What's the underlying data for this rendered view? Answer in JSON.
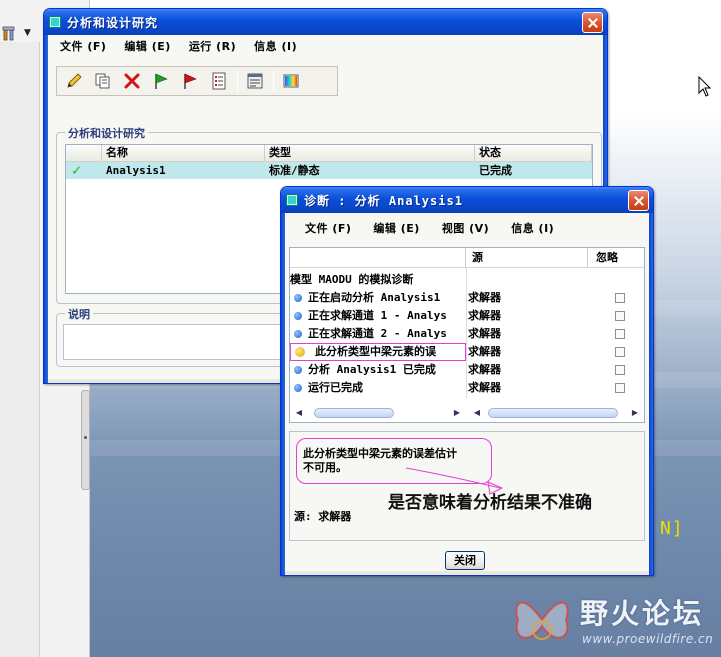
{
  "main_window": {
    "title": "分析和设计研究",
    "menu": [
      {
        "label": "文件 (F)"
      },
      {
        "label": "编辑 (E)"
      },
      {
        "label": "运行 (R)"
      },
      {
        "label": "信息 (I)"
      }
    ],
    "toolbar_icons": [
      "pencil-icon",
      "copy-icon",
      "delete-icon",
      "green-flag-icon",
      "red-flag-icon",
      "list-icon",
      "info-panel-icon",
      "graph-icon"
    ],
    "study_group_label": "分析和设计研究",
    "columns": [
      "名称",
      "类型",
      "状态"
    ],
    "rows": [
      {
        "name": "Analysis1",
        "type": "标准/静态",
        "status": "已完成"
      }
    ],
    "description_label": "说明"
  },
  "diag_window": {
    "title": "诊断 : 分析 Analysis1",
    "menu": [
      {
        "label": "文件 (F)"
      },
      {
        "label": "编辑 (E)"
      },
      {
        "label": "视图 (V)"
      },
      {
        "label": "信息 (I)"
      }
    ],
    "columns": {
      "source": "源",
      "ignore": "忽略"
    },
    "model_heading": "模型 MAODU 的模拟诊断",
    "rows": [
      {
        "message": "正在启动分析 Analysis1",
        "source": "求解器",
        "icon": "info-icon"
      },
      {
        "message": "正在求解通道 1 - Analys",
        "source": "求解器",
        "icon": "info-icon"
      },
      {
        "message": "正在求解通道 2 - Analys",
        "source": "求解器",
        "icon": "info-icon"
      },
      {
        "message": "此分析类型中梁元素的误",
        "source": "求解器",
        "icon": "warning-icon"
      },
      {
        "message": "分析 Analysis1 已完成",
        "source": "求解器",
        "icon": "info-icon"
      },
      {
        "message": "运行已完成",
        "source": "求解器",
        "icon": "info-icon"
      }
    ],
    "detail_line1": "此分析类型中梁元素的误差估计",
    "detail_line2": "不可用。",
    "annotation": "是否意味着分析结果不准确",
    "source_line": "源: 求解器",
    "close_label": "关闭"
  },
  "background": {
    "bracket_text": "N]"
  },
  "watermark": {
    "name": "野火论坛",
    "url": "www.proewildfire.cn"
  },
  "colors": {
    "title_blue": "#0a4fd8",
    "selected_row": "#bfe8ec",
    "highlight_magenta": "#e040d8",
    "check_green": "#2bb326"
  }
}
